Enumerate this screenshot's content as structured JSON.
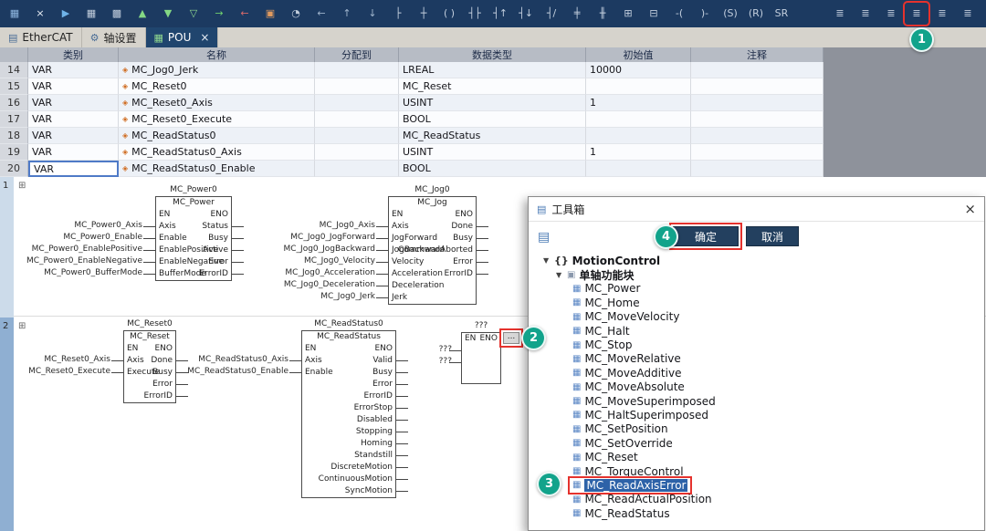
{
  "colors": {
    "annotation_teal": "#12a38b",
    "highlight_red": "#e5322d",
    "selection_blue": "#2d62a8",
    "toolbar_bg": "#1c3a61",
    "active_tab_bg": "#20456e"
  },
  "toolbar": {
    "left_icons": [
      {
        "n": "project-window-icon",
        "g": "▦",
        "c": "#8fb7e0"
      },
      {
        "n": "close-editor-icon",
        "g": "×",
        "c": "#e8eef5"
      },
      {
        "n": "run-device-icon",
        "g": "▶",
        "c": "#6fb3e8"
      },
      {
        "n": "grid-open-icon",
        "g": "▦",
        "c": "#c2cedd"
      },
      {
        "n": "grid-close-icon",
        "g": "▩",
        "c": "#c2cedd"
      },
      {
        "n": "archive-up-icon",
        "g": "▲",
        "c": "#84d884"
      },
      {
        "n": "archive-down-icon",
        "g": "▼",
        "c": "#84d884"
      },
      {
        "n": "filter-icon",
        "g": "▽",
        "c": "#8fd88f"
      },
      {
        "n": "login-icon",
        "g": "→",
        "c": "#6fcf6f"
      },
      {
        "n": "logout-icon",
        "g": "←",
        "c": "#d96a6a"
      },
      {
        "n": "compare-icon",
        "g": "▣",
        "c": "#e09a5f"
      },
      {
        "n": "measure-icon",
        "g": "◔",
        "c": "#c2cedd"
      },
      {
        "n": "nav-back-icon",
        "g": "←",
        "c": "#9fb4cc"
      },
      {
        "n": "nav-up-icon",
        "g": "↑",
        "c": "#9fb4cc"
      },
      {
        "n": "nav-down-icon",
        "g": "↓",
        "c": "#9fb4cc"
      },
      {
        "n": "insert-network-icon",
        "g": "├",
        "c": "#c2cedd"
      },
      {
        "n": "insert-network-below-icon",
        "g": "┼",
        "c": "#c2cedd"
      },
      {
        "n": "insert-coil-icon",
        "g": "( )",
        "c": "#c2cedd"
      },
      {
        "n": "insert-contact-icon",
        "g": "┤├",
        "c": "#c2cedd"
      },
      {
        "n": "contact-rising-icon",
        "g": "┤↑",
        "c": "#c2cedd"
      },
      {
        "n": "contact-falling-icon",
        "g": "┤↓",
        "c": "#c2cedd"
      },
      {
        "n": "contact-negated-icon",
        "g": "┤/",
        "c": "#c2cedd"
      },
      {
        "n": "parallel-contact-icon",
        "g": "╪",
        "c": "#c2cedd"
      },
      {
        "n": "parallel-negated-icon",
        "g": "╫",
        "c": "#c2cedd"
      },
      {
        "n": "insert-fb-icon",
        "g": "⊞",
        "c": "#c2cedd"
      },
      {
        "n": "insert-empty-fb-icon",
        "g": "⊟",
        "c": "#c2cedd"
      },
      {
        "n": "open-branch-icon",
        "g": "-(",
        "c": "#c2cedd"
      },
      {
        "n": "close-branch-icon",
        "g": ")-",
        "c": "#c2cedd"
      },
      {
        "n": "set-coil-icon",
        "g": "(S)",
        "c": "#c2cedd"
      },
      {
        "n": "reset-coil-icon",
        "g": "(R)",
        "c": "#c2cedd"
      },
      {
        "n": "sr-block-icon",
        "g": "SR",
        "c": "#c2cedd"
      }
    ],
    "right_icons": [
      {
        "n": "view-list-icon",
        "g": "≣",
        "c": "#c2cedd"
      },
      {
        "n": "view-columns-icon",
        "g": "≣",
        "c": "#c2cedd"
      },
      {
        "n": "view-table-icon",
        "g": "≣",
        "c": "#c2cedd"
      },
      {
        "n": "add-variable-icon",
        "g": "≣",
        "c": "#c2cedd",
        "hl": true
      },
      {
        "n": "view-cross-ref-icon",
        "g": "≣",
        "c": "#c2cedd"
      },
      {
        "n": "view-help-icon",
        "g": "≣",
        "c": "#c2cedd"
      }
    ]
  },
  "tabs": [
    {
      "icon": "▤",
      "label": "EtherCAT"
    },
    {
      "icon": "⚙",
      "label": "轴设置"
    },
    {
      "icon": "▦",
      "label": "POU",
      "close": "×"
    }
  ],
  "var_table": {
    "row_icon": "◈",
    "headers": [
      "类别",
      "名称",
      "分配到",
      "数据类型",
      "初始值",
      "注释"
    ],
    "rows": [
      {
        "num": "14",
        "cat": "VAR",
        "name": "MC_Jog0_Jerk",
        "assign": "",
        "type": "LREAL",
        "init": "10000",
        "comment": ""
      },
      {
        "num": "15",
        "cat": "VAR",
        "name": "MC_Reset0",
        "assign": "",
        "type": "MC_Reset",
        "init": "",
        "comment": ""
      },
      {
        "num": "16",
        "cat": "VAR",
        "name": "MC_Reset0_Axis",
        "assign": "",
        "type": "USINT",
        "init": "1",
        "comment": ""
      },
      {
        "num": "17",
        "cat": "VAR",
        "name": "MC_Reset0_Execute",
        "assign": "",
        "type": "BOOL",
        "init": "",
        "comment": ""
      },
      {
        "num": "18",
        "cat": "VAR",
        "name": "MC_ReadStatus0",
        "assign": "",
        "type": "MC_ReadStatus",
        "init": "",
        "comment": ""
      },
      {
        "num": "19",
        "cat": "VAR",
        "name": "MC_ReadStatus0_Axis",
        "assign": "",
        "type": "USINT",
        "init": "1",
        "comment": ""
      },
      {
        "num": "20",
        "cat": "VAR",
        "name": "MC_ReadStatus0_Enable",
        "assign": "",
        "type": "BOOL",
        "init": "",
        "comment": "",
        "edit": true
      }
    ]
  },
  "fbd": {
    "rung1_num": "1",
    "rung2_num": "2",
    "collapse_glyph": "⊞",
    "blocks": {
      "power": {
        "instance": "MC_Power0",
        "type": "MC_Power",
        "rows": [
          {
            "l": "EN",
            "r": "ENO"
          },
          {
            "l": "Axis",
            "r": "Status"
          },
          {
            "l": "Enable",
            "r": "Busy"
          },
          {
            "l": "EnablePositive",
            "r": "Active"
          },
          {
            "l": "EnableNegative",
            "r": "Error"
          },
          {
            "l": "BufferMode",
            "r": "ErrorID"
          }
        ],
        "inputs": [
          "MC_Power0_Axis",
          "MC_Power0_Enable",
          "MC_Power0_EnablePositive",
          "MC_Power0_EnableNegative",
          "MC_Power0_BufferMode"
        ]
      },
      "jog": {
        "instance": "MC_Jog0",
        "type": "MC_Jog",
        "rows": [
          {
            "l": "EN",
            "r": "ENO"
          },
          {
            "l": "Axis",
            "r": "Done"
          },
          {
            "l": "JogForward",
            "r": "Busy"
          },
          {
            "l": "JogBackward",
            "r": "CommandAborted"
          },
          {
            "l": "Velocity",
            "r": "Error"
          },
          {
            "l": "Acceleration",
            "r": "ErrorID"
          },
          {
            "l": "Deceleration",
            "r": ""
          },
          {
            "l": "Jerk",
            "r": ""
          }
        ],
        "inputs": [
          "MC_Jog0_Axis",
          "MC_Jog0_JogForward",
          "MC_Jog0_JogBackward",
          "MC_Jog0_Velocity",
          "MC_Jog0_Acceleration",
          "MC_Jog0_Deceleration",
          "MC_Jog0_Jerk"
        ]
      },
      "reset": {
        "instance": "MC_Reset0",
        "type": "MC_Reset",
        "rows": [
          {
            "l": "EN",
            "r": "ENO"
          },
          {
            "l": "Axis",
            "r": "Done"
          },
          {
            "l": "Execute",
            "r": "Busy"
          },
          {
            "l": "",
            "r": "Error"
          },
          {
            "l": "",
            "r": "ErrorID"
          }
        ],
        "inputs": [
          "MC_Reset0_Axis",
          "MC_Reset0_Execute"
        ]
      },
      "readstatus": {
        "instance": "MC_ReadStatus0",
        "type": "MC_ReadStatus",
        "rows": [
          {
            "l": "EN",
            "r": "ENO"
          },
          {
            "l": "Axis",
            "r": "Valid"
          },
          {
            "l": "Enable",
            "r": "Busy"
          },
          {
            "l": "",
            "r": "Error"
          },
          {
            "l": "",
            "r": "ErrorID"
          },
          {
            "l": "",
            "r": "ErrorStop"
          },
          {
            "l": "",
            "r": "Disabled"
          },
          {
            "l": "",
            "r": "Stopping"
          },
          {
            "l": "",
            "r": "Homing"
          },
          {
            "l": "",
            "r": "Standstill"
          },
          {
            "l": "",
            "r": "DiscreteMotion"
          },
          {
            "l": "",
            "r": "ContinuousMotion"
          },
          {
            "l": "",
            "r": "SyncMotion"
          }
        ],
        "inputs": [
          "MC_ReadStatus0_Axis",
          "MC_ReadStatus0_Enable"
        ]
      },
      "newfb": {
        "instance": "???",
        "rows": [
          {
            "l": "EN",
            "r": "ENO"
          },
          {
            "l": " ",
            "r": ""
          },
          {
            "l": " ",
            "r": ""
          }
        ],
        "inputs": [
          "???",
          "???"
        ],
        "button": "..."
      }
    }
  },
  "toolbox": {
    "title": "工具箱",
    "close_glyph": "×",
    "library_icon": "▤",
    "ok_label": "确定",
    "cancel_label": "取消",
    "tree": {
      "expander": "▼",
      "root_icon": "{}",
      "root_label": "MotionControl",
      "group_icon": "▣",
      "group_label": "单轴功能块",
      "item_icon": "▦",
      "items": [
        {
          "label": "MC_Power"
        },
        {
          "label": "MC_Home"
        },
        {
          "label": "MC_MoveVelocity"
        },
        {
          "label": "MC_Halt"
        },
        {
          "label": "MC_Stop"
        },
        {
          "label": "MC_MoveRelative"
        },
        {
          "label": "MC_MoveAdditive"
        },
        {
          "label": "MC_MoveAbsolute"
        },
        {
          "label": "MC_MoveSuperimposed"
        },
        {
          "label": "MC_HaltSuperimposed"
        },
        {
          "label": "MC_SetPosition"
        },
        {
          "label": "MC_SetOverride"
        },
        {
          "label": "MC_Reset"
        },
        {
          "label": "MC_TorqueControl"
        },
        {
          "label": "MC_ReadAxisError",
          "selected": true
        },
        {
          "label": "MC_ReadActualPosition"
        },
        {
          "label": "MC_ReadStatus"
        }
      ]
    }
  },
  "annotations": {
    "a1": "1",
    "a2": "2",
    "a3": "3",
    "a4": "4"
  }
}
